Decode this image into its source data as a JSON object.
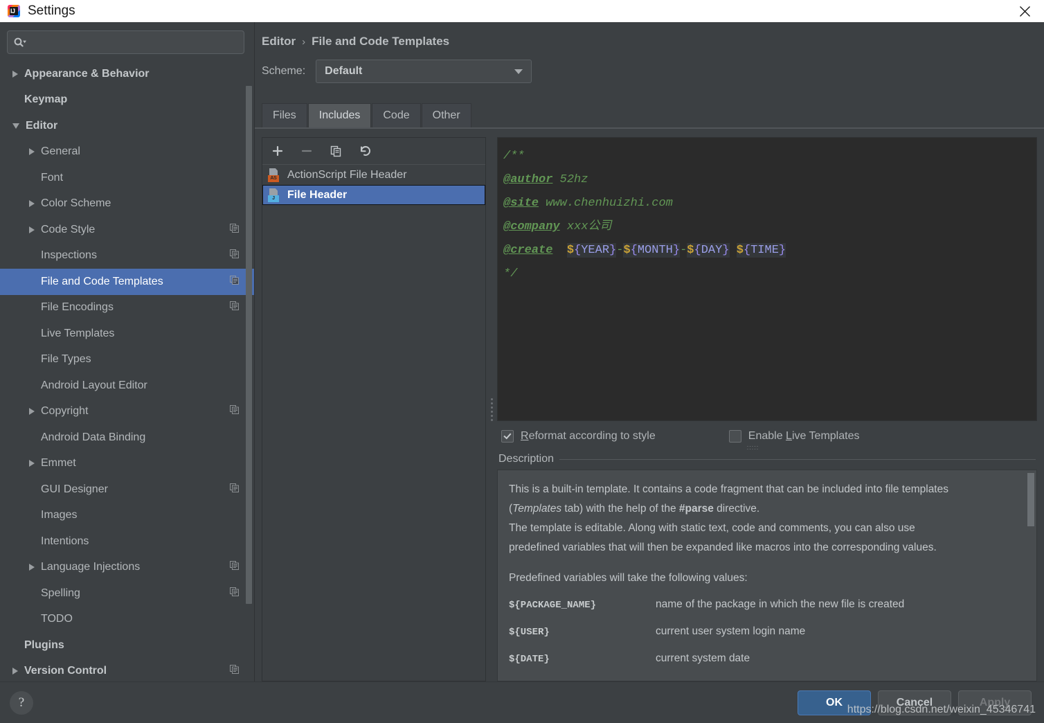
{
  "window": {
    "title": "Settings",
    "close_label": "✕"
  },
  "search": {
    "value": "",
    "placeholder": ""
  },
  "sidebar": {
    "items": [
      {
        "label": "Appearance & Behavior",
        "arrow": "right",
        "indent": 0,
        "bold": true,
        "copyable": false,
        "selected": false
      },
      {
        "label": "Keymap",
        "arrow": "none",
        "indent": 0,
        "bold": true,
        "copyable": false,
        "selected": false
      },
      {
        "label": "Editor",
        "arrow": "down",
        "indent": 0,
        "bold": true,
        "copyable": false,
        "selected": false
      },
      {
        "label": "General",
        "arrow": "right",
        "indent": 1,
        "bold": false,
        "copyable": false,
        "selected": false
      },
      {
        "label": "Font",
        "arrow": "none",
        "indent": 1,
        "bold": false,
        "copyable": false,
        "selected": false
      },
      {
        "label": "Color Scheme",
        "arrow": "right",
        "indent": 1,
        "bold": false,
        "copyable": false,
        "selected": false
      },
      {
        "label": "Code Style",
        "arrow": "right",
        "indent": 1,
        "bold": false,
        "copyable": true,
        "selected": false
      },
      {
        "label": "Inspections",
        "arrow": "none",
        "indent": 1,
        "bold": false,
        "copyable": true,
        "selected": false
      },
      {
        "label": "File and Code Templates",
        "arrow": "none",
        "indent": 1,
        "bold": false,
        "copyable": true,
        "selected": true
      },
      {
        "label": "File Encodings",
        "arrow": "none",
        "indent": 1,
        "bold": false,
        "copyable": true,
        "selected": false
      },
      {
        "label": "Live Templates",
        "arrow": "none",
        "indent": 1,
        "bold": false,
        "copyable": false,
        "selected": false
      },
      {
        "label": "File Types",
        "arrow": "none",
        "indent": 1,
        "bold": false,
        "copyable": false,
        "selected": false
      },
      {
        "label": "Android Layout Editor",
        "arrow": "none",
        "indent": 1,
        "bold": false,
        "copyable": false,
        "selected": false
      },
      {
        "label": "Copyright",
        "arrow": "right",
        "indent": 1,
        "bold": false,
        "copyable": true,
        "selected": false
      },
      {
        "label": "Android Data Binding",
        "arrow": "none",
        "indent": 1,
        "bold": false,
        "copyable": false,
        "selected": false
      },
      {
        "label": "Emmet",
        "arrow": "right",
        "indent": 1,
        "bold": false,
        "copyable": false,
        "selected": false
      },
      {
        "label": "GUI Designer",
        "arrow": "none",
        "indent": 1,
        "bold": false,
        "copyable": true,
        "selected": false
      },
      {
        "label": "Images",
        "arrow": "none",
        "indent": 1,
        "bold": false,
        "copyable": false,
        "selected": false
      },
      {
        "label": "Intentions",
        "arrow": "none",
        "indent": 1,
        "bold": false,
        "copyable": false,
        "selected": false
      },
      {
        "label": "Language Injections",
        "arrow": "right",
        "indent": 1,
        "bold": false,
        "copyable": true,
        "selected": false
      },
      {
        "label": "Spelling",
        "arrow": "none",
        "indent": 1,
        "bold": false,
        "copyable": true,
        "selected": false
      },
      {
        "label": "TODO",
        "arrow": "none",
        "indent": 1,
        "bold": false,
        "copyable": false,
        "selected": false
      },
      {
        "label": "Plugins",
        "arrow": "none",
        "indent": 0,
        "bold": true,
        "copyable": false,
        "selected": false
      },
      {
        "label": "Version Control",
        "arrow": "right",
        "indent": 0,
        "bold": true,
        "copyable": true,
        "selected": false
      }
    ]
  },
  "breadcrumb": {
    "parent": "Editor",
    "separator": "›",
    "current": "File and Code Templates"
  },
  "scheme": {
    "label": "Scheme:",
    "value": "Default"
  },
  "tabs": [
    {
      "label": "Files",
      "active": false
    },
    {
      "label": "Includes",
      "active": true
    },
    {
      "label": "Code",
      "active": false
    },
    {
      "label": "Other",
      "active": false
    }
  ],
  "list_toolbar": [
    {
      "name": "add-button",
      "glyph": "+",
      "disabled": false
    },
    {
      "name": "remove-button",
      "glyph": "−",
      "disabled": true
    },
    {
      "name": "copy-button",
      "glyph": "copy",
      "disabled": false
    },
    {
      "name": "reset-button",
      "glyph": "undo",
      "disabled": false
    }
  ],
  "template_list": [
    {
      "label": "ActionScript File Header",
      "badge": "AS",
      "badge_color": "#cc5a21",
      "selected": false
    },
    {
      "label": "File Header",
      "badge": "J",
      "badge_color": "#54b0e0",
      "selected": true
    }
  ],
  "code": {
    "lines": [
      {
        "type": "comment",
        "text": "/**"
      },
      {
        "type": "tagline",
        "tag": "@author",
        "text": " 52hz"
      },
      {
        "type": "tagline",
        "tag": "@site",
        "text": " www.chenhuizhi.com"
      },
      {
        "type": "tagline",
        "tag": "@company",
        "text": " xxx公司"
      },
      {
        "type": "varline",
        "tag": "@create",
        "vars": [
          "${YEAR}",
          "${MONTH}",
          "${DAY}",
          "${TIME}"
        ],
        "raw": "@create  ${YEAR}-${MONTH}-${DAY} ${TIME}"
      },
      {
        "type": "comment",
        "text": "*/"
      }
    ],
    "full_text": "/**\n@author 52hz\n@site www.chenhuizhi.com\n@company xxx公司\n@create  ${YEAR}-${MONTH}-${DAY} ${TIME}\n*/"
  },
  "options": {
    "reformat": {
      "label": "Reformat according to style",
      "mnemonic": "R",
      "checked": true
    },
    "live_templates": {
      "label": "Enable Live Templates",
      "mnemonic": "L",
      "checked": false
    }
  },
  "description": {
    "title": "Description",
    "paragraph1_a": "This is a built-in template. It contains a code fragment that can be included into file templates",
    "paragraph1_b_open": "(",
    "paragraph1_italic": "Templates",
    "paragraph1_b_mid": " tab) with the help of the ",
    "paragraph1_bold": "#parse",
    "paragraph1_b_end": " directive.",
    "paragraph2": "The template is editable. Along with static text, code and comments, you can also use",
    "paragraph3": "predefined variables that will then be expanded like macros into the corresponding values.",
    "variables_intro": "Predefined variables will take the following values:",
    "variables": [
      {
        "name": "${PACKAGE_NAME}",
        "desc": "name of the package in which the new file is created"
      },
      {
        "name": "${USER}",
        "desc": "current user system login name"
      },
      {
        "name": "${DATE}",
        "desc": "current system date"
      }
    ]
  },
  "footer": {
    "help_label": "?",
    "ok_label": "OK",
    "cancel_label": "Cancel",
    "apply_label": "Apply"
  },
  "watermark": "https://blog.csdn.net/weixin_45346741",
  "colors": {
    "selection": "#4b6eaf",
    "primary_button": "#37618e",
    "panel": "#3c4043",
    "editor_bg": "#2b2b2b",
    "comment_green": "#629755",
    "var_orange": "#c9a136",
    "var_lavender": "#9a9ee8"
  }
}
